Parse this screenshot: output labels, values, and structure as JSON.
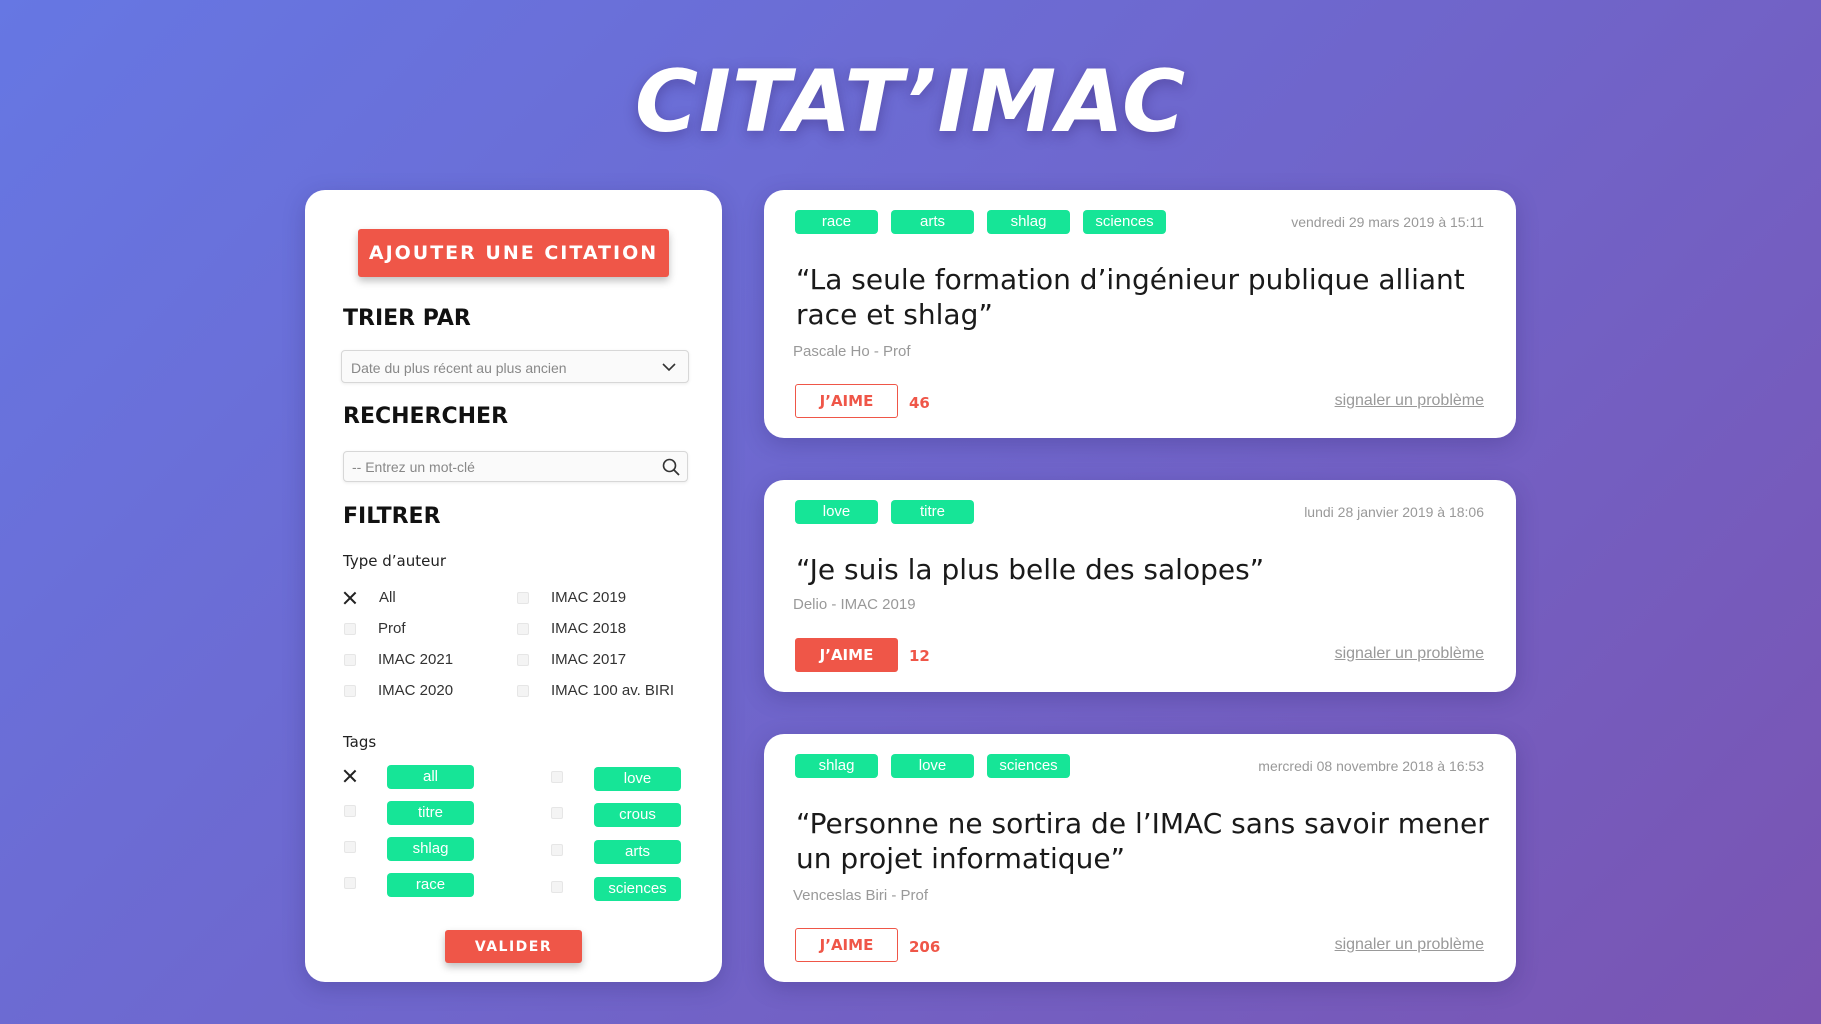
{
  "app": {
    "title": "CITAT’IMAC"
  },
  "sidebar": {
    "add_button": "AJOUTER UNE CITATION",
    "sort": {
      "title": "TRIER PAR",
      "selected": "Date du plus récent au plus ancien"
    },
    "search": {
      "title": "RECHERCHER",
      "placeholder": "-- Entrez un mot-clé"
    },
    "filter": {
      "title": "FILTRER",
      "author_type_label": "Type d’auteur",
      "author_types": [
        {
          "label": "All",
          "checked": true
        },
        {
          "label": "Prof",
          "checked": false
        },
        {
          "label": "IMAC 2021",
          "checked": false
        },
        {
          "label": "IMAC 2020",
          "checked": false
        },
        {
          "label": "IMAC 2019",
          "checked": false
        },
        {
          "label": "IMAC 2018",
          "checked": false
        },
        {
          "label": "IMAC 2017",
          "checked": false
        },
        {
          "label": "IMAC 100 av. BIRI",
          "checked": false
        }
      ],
      "tags_label": "Tags",
      "tags": [
        {
          "label": "all",
          "checked": true
        },
        {
          "label": "titre",
          "checked": false
        },
        {
          "label": "shlag",
          "checked": false
        },
        {
          "label": "race",
          "checked": false
        },
        {
          "label": "love",
          "checked": false
        },
        {
          "label": "crous",
          "checked": false
        },
        {
          "label": "arts",
          "checked": false
        },
        {
          "label": "sciences",
          "checked": false
        }
      ]
    },
    "submit_button": "VALIDER"
  },
  "quotes": [
    {
      "tags": [
        "race",
        "arts",
        "shlag",
        "sciences"
      ],
      "date": "vendredi 29 mars 2019 à 15:11",
      "text": "“La seule formation d’ingénieur publique alliant race et shlag”",
      "author": "Pascale Ho - Prof",
      "like_label": "J’AIME",
      "likes": "46",
      "liked": false,
      "report_label": "signaler un problème"
    },
    {
      "tags": [
        "love",
        "titre"
      ],
      "date": "lundi 28 janvier 2019 à 18:06",
      "text": "“Je suis la plus belle des salopes”",
      "author": "Delio - IMAC 2019",
      "like_label": "J’AIME",
      "likes": "12",
      "liked": true,
      "report_label": "signaler un problème"
    },
    {
      "tags": [
        "shlag",
        "love",
        "sciences"
      ],
      "date": "mercredi 08 novembre 2018 à 16:53",
      "text": "“Personne ne sortira de l’IMAC sans savoir mener un projet informatique”",
      "author": "Venceslas Biri - Prof",
      "like_label": "J’AIME",
      "likes": "206",
      "liked": false,
      "report_label": "signaler un problème"
    }
  ],
  "colors": {
    "accent": "#ef5648",
    "tag": "#16e597",
    "bg_start": "#6677e3",
    "bg_end": "#7a54b2"
  },
  "icons": {
    "sort_dropdown": "chevron-down-icon",
    "search": "search-icon",
    "checked": "close-icon"
  }
}
